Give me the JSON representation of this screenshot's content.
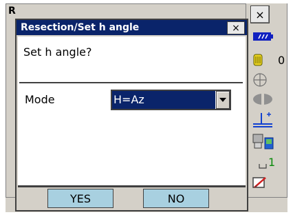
{
  "background_window": {
    "title_fragment": "R"
  },
  "dialog": {
    "title": "Resection/Set h angle",
    "close_label": "×",
    "prompt": "Set h angle?",
    "mode": {
      "label": "Mode",
      "selected_value": "H=Az"
    },
    "buttons": {
      "yes": "YES",
      "no": "NO"
    }
  },
  "status_panel": {
    "close_label": "×",
    "prism_constant": "0",
    "input_mode": "1",
    "icons": [
      "battery-icon",
      "prism-icon",
      "tilt-icon",
      "laser-pointer-icon",
      "target-icon",
      "communication-icon",
      "input-mode-icon",
      "memory-icon"
    ]
  },
  "colors": {
    "title_bar": "#0a246a",
    "selection": "#0a246a",
    "softkey": "#a8d0e0",
    "panel": "#d4d0c8",
    "input_mode": "#0a8a0a"
  }
}
